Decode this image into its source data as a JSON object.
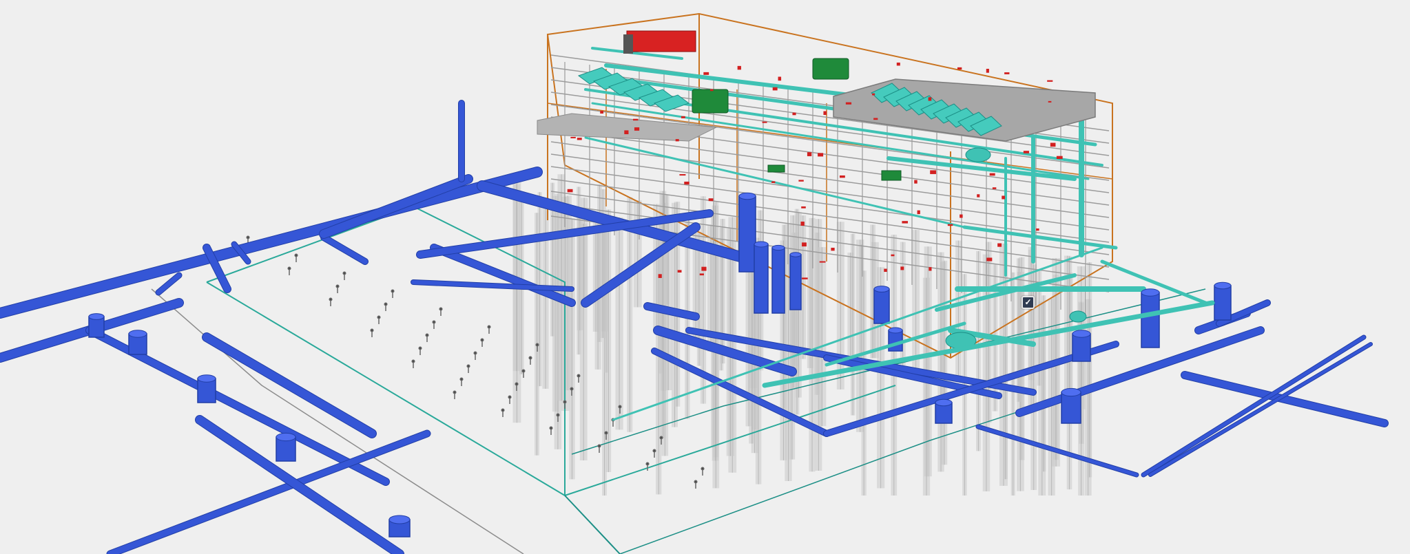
{
  "viewer": {
    "background": "#efefef",
    "marker": {
      "glyph": "✓",
      "icon": "checkmark-icon",
      "color": "#2f3b52"
    }
  },
  "palette": {
    "blue_pipe": "#3556d6",
    "blue_pipe_dark": "#223fa6",
    "teal_pipe": "#3fc2b4",
    "teal_dark": "#1c8f86",
    "orange_frame": "#c9731f",
    "red_component": "#d22020",
    "green_equipment": "#1f8a3a",
    "grey_structure": "#9b9b9b",
    "grey_pile": "#c9c9c9",
    "roof": "#9a9a9a"
  }
}
